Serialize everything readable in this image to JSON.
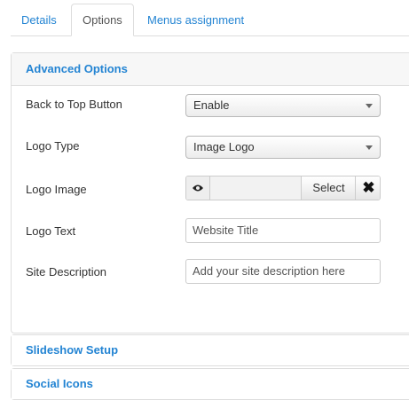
{
  "tabs": [
    {
      "label": "Details"
    },
    {
      "label": "Options"
    },
    {
      "label": "Menus assignment"
    }
  ],
  "advanced_options": {
    "title": "Advanced Options",
    "fields": {
      "back_to_top": {
        "label": "Back to Top Button",
        "value": "Enable"
      },
      "logo_type": {
        "label": "Logo Type",
        "value": "Image Logo"
      },
      "logo_image": {
        "label": "Logo Image",
        "select_label": "Select",
        "clear_icon": "close-icon",
        "preview_icon": "eye-icon"
      },
      "logo_text": {
        "label": "Logo Text",
        "placeholder": "Website Title"
      },
      "site_description": {
        "label": "Site Description",
        "placeholder": "Add your site description here"
      }
    }
  },
  "sections": [
    {
      "title": "Slideshow Setup"
    },
    {
      "title": "Social Icons"
    }
  ],
  "colors": {
    "link": "#2384d3",
    "border": "#dddddd"
  }
}
